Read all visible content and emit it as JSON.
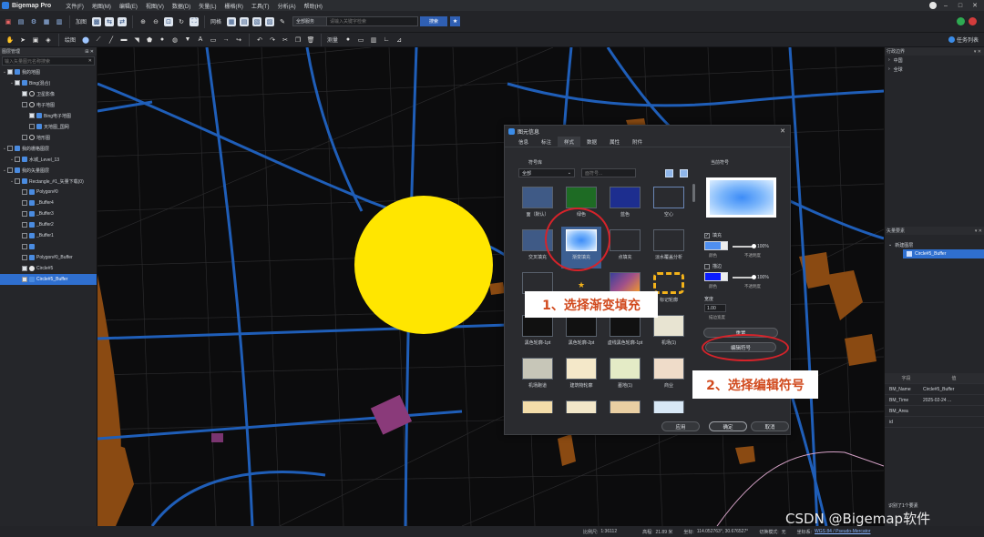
{
  "app": {
    "title": "Bigemap Pro"
  },
  "menu": [
    "文件(F)",
    "地图(M)",
    "编辑(E)",
    "视图(V)",
    "数据(D)",
    "矢量(L)",
    "栅格(R)",
    "工具(T)",
    "分析(A)",
    "帮助(H)"
  ],
  "toolbar": {
    "add_map_label": "加图",
    "grid_label": "网格",
    "search_scope": "全部服务",
    "search_placeholder": "请输入关键字检索",
    "search_button": "搜索",
    "draw_label": "绘图",
    "measure_label": "测量",
    "tasklist_label": "任务列表"
  },
  "left_panel": {
    "title": "图层管理",
    "search_placeholder": "输入矢量图元名称搜索",
    "items": [
      {
        "label": "我的地图",
        "level": 0
      },
      {
        "label": "Bing(混合)",
        "level": 1
      },
      {
        "label": "卫星影像",
        "level": 2
      },
      {
        "label": "电子地图",
        "level": 2
      },
      {
        "label": "Bing电子地图",
        "level": 3
      },
      {
        "label": "天地图_国网",
        "level": 3
      },
      {
        "label": "地形图",
        "level": 2
      },
      {
        "label": "我的栅格图层",
        "level": 0
      },
      {
        "label": "水城_Level_13",
        "level": 1
      },
      {
        "label": "我的矢量图层",
        "level": 0
      },
      {
        "label": "Rectangle_#1_矢量下载(0)",
        "level": 1
      },
      {
        "label": "Polygon#0",
        "level": 2
      },
      {
        "label": "_Buffer4",
        "level": 2
      },
      {
        "label": "_Buffer3",
        "level": 2
      },
      {
        "label": "_Buffer2",
        "level": 2
      },
      {
        "label": "_Buffer1",
        "level": 2
      },
      {
        "label": "",
        "level": 2
      },
      {
        "label": "Polygon#0_Buffer",
        "level": 2
      },
      {
        "label": "Circle#5",
        "level": 2
      },
      {
        "label": "Circle#5_Buffer",
        "level": 2
      }
    ]
  },
  "right_panel": {
    "top_title": "行政边界",
    "top_items": [
      "中国",
      "全球"
    ],
    "mid_title": "矢量要素",
    "mid_items": [
      "新建图层",
      "Circle#5_Buffer"
    ],
    "attr_headers": [
      "字段",
      "值"
    ],
    "attrs": [
      {
        "k": "BM_Name",
        "v": "Circle#5_Buffer"
      },
      {
        "k": "BM_Time",
        "v": "2025-02-24 ..."
      },
      {
        "k": "BM_Area",
        "v": ""
      },
      {
        "k": "id",
        "v": ""
      }
    ],
    "found": "识别了1个要素"
  },
  "statusbar": {
    "scale_label": "比例尺:",
    "scale": "1:36112",
    "zoom_label": "高程:",
    "zoom": "21.89 米",
    "coord_label": "坐标:",
    "coord": "114.052763°, 30.676527°",
    "proj_label": "切换模式:",
    "proj_value": "无",
    "crs_label": "坐标系:",
    "crs": "WGS 84 / Pseudo-Mercator"
  },
  "dialog": {
    "title": "图元信息",
    "tabs": [
      "信息",
      "标注",
      "样式",
      "数据",
      "属性",
      "附件"
    ],
    "active_tab": "样式",
    "symbol_lib_label": "符号库",
    "symbol_filter": "全部",
    "symbol_search_placeholder": "面符号...",
    "current_symbol_label": "当前符号",
    "symbols": [
      {
        "label": "面（默认）",
        "color": "#3f5a86"
      },
      {
        "label": "绿色",
        "color": "#1e6b24"
      },
      {
        "label": "蓝色",
        "color": "#1d2e8f"
      },
      {
        "label": "空心",
        "color": "transparent"
      },
      {
        "label": "交叉填充",
        "color": "#3f5a86"
      },
      {
        "label": "渐变填充",
        "color": "gradient"
      },
      {
        "label": "点填充",
        "color": "#2a2b2f"
      },
      {
        "label": "淡水覆盖分析",
        "color": "#2a2b2f"
      },
      {
        "label": "",
        "color": "#2a2b2f"
      },
      {
        "label": "★",
        "color": "#2a2b2f"
      },
      {
        "label": "",
        "color": "orange-gradient"
      },
      {
        "label": "标记轮廓",
        "color": "dashed-gold"
      },
      {
        "label": "黑色轮廓-1pt",
        "color": "#111"
      },
      {
        "label": "黑色轮廓-2pt",
        "color": "#111"
      },
      {
        "label": "虚线黑色轮廓-1pt",
        "color": "#111"
      },
      {
        "label": "机场(1)",
        "color": "#e8e4d2"
      },
      {
        "label": "机场跑道",
        "color": "#c7c6b8"
      },
      {
        "label": "建筑物轮廓",
        "color": "#f4e8c9"
      },
      {
        "label": "墓地(1)",
        "color": "#e4ebc6"
      },
      {
        "label": "商业",
        "color": "#efdcc9"
      },
      {
        "label": "",
        "color": "#f3ddaa"
      },
      {
        "label": "",
        "color": "#f2e7c9"
      },
      {
        "label": "",
        "color": "#e9cfa3"
      },
      {
        "label": "",
        "color": "#d8e8f6"
      }
    ],
    "fill_label": "填充",
    "fill_opacity": "100%",
    "fill_color_caption": "颜色",
    "fill_opacity_caption": "不透明度",
    "outline_label": "描边",
    "outline_opacity": "100%",
    "outline_color_caption": "颜色",
    "outline_opacity_caption": "不透明度",
    "width_label": "宽度",
    "width_value": "1.00",
    "width_caption": "描边宽度",
    "reset_button": "重置",
    "edit_symbol_button": "编辑符号",
    "apply_button": "应用",
    "ok_button": "确定",
    "cancel_button": "取消"
  },
  "annotations": {
    "step1": "1、选择渐变填充",
    "step2": "2、选择编辑符号"
  },
  "watermark": "CSDN @Bigemap软件",
  "colors": {
    "accent": "#2f6fcf",
    "road": "#1f5eb8",
    "water": "#8a4a12",
    "circle": "#ffe600",
    "annotation": "#d6232a"
  }
}
